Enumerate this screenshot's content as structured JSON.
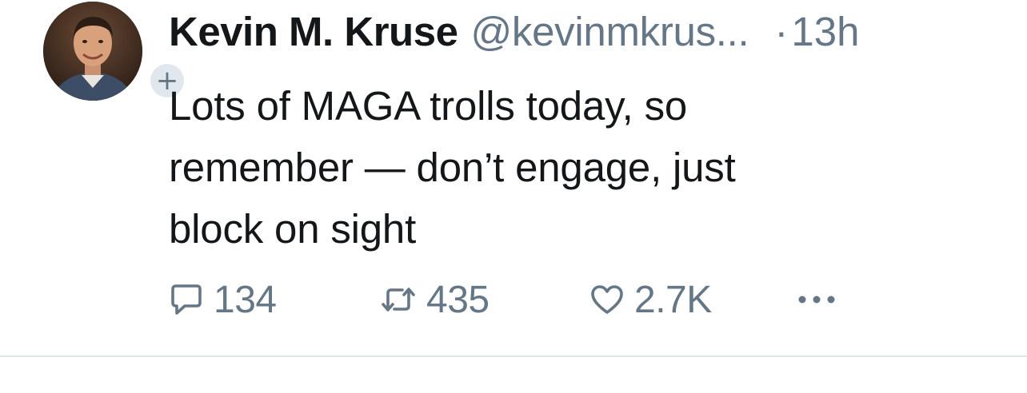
{
  "tweet": {
    "author": {
      "display_name": "Kevin M. Kruse",
      "handle": "@kevinmkrus...",
      "avatar_icon": "profile-photo",
      "follow_badge_symbol": "+"
    },
    "separator": "·",
    "timestamp": "13h",
    "text_lines": [
      "Lots of MAGA trolls today, so",
      "remember — don’t engage, just",
      "block on sight"
    ],
    "actions": {
      "reply": {
        "icon": "reply-icon",
        "count": "134"
      },
      "retweet": {
        "icon": "retweet-icon",
        "count": "435"
      },
      "like": {
        "icon": "heart-icon",
        "count": "2.7K"
      },
      "more": {
        "icon": "more-icon"
      }
    }
  },
  "colors": {
    "text_primary": "#14171a",
    "text_secondary": "#657786",
    "divider": "#e1e8ed"
  }
}
